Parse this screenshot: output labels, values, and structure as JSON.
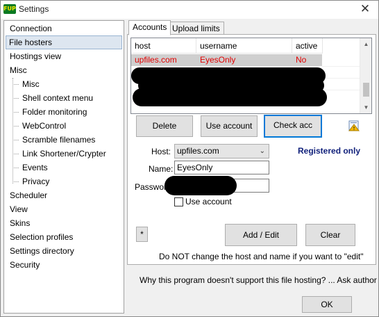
{
  "window": {
    "app_icon_text": "FUP",
    "title": "Settings",
    "close_glyph": "✕"
  },
  "sidebar": {
    "items": [
      {
        "label": "Connection"
      },
      {
        "label": "File hosters"
      },
      {
        "label": "Hostings view"
      },
      {
        "label": "Misc"
      },
      {
        "label": "Misc"
      },
      {
        "label": "Shell context menu"
      },
      {
        "label": "Folder monitoring"
      },
      {
        "label": "WebControl"
      },
      {
        "label": "Scramble filenames"
      },
      {
        "label": "Link Shortener/Crypter"
      },
      {
        "label": "Events"
      },
      {
        "label": "Privacy"
      },
      {
        "label": "Scheduler"
      },
      {
        "label": "View"
      },
      {
        "label": "Skins"
      },
      {
        "label": "Selection profiles"
      },
      {
        "label": "Settings directory"
      },
      {
        "label": "Security"
      }
    ],
    "selected_index": 1
  },
  "tabs": [
    {
      "label": "Accounts"
    },
    {
      "label": "Upload limits"
    }
  ],
  "accounts_list": {
    "columns": [
      "host",
      "username",
      "active"
    ],
    "rows": [
      {
        "host": "upfiles.com",
        "username": "EyesOnly",
        "active": "No"
      }
    ]
  },
  "buttons": {
    "delete": "Delete",
    "use_account": "Use account",
    "check_acc": "Check acc",
    "add_edit": "Add / Edit",
    "clear": "Clear",
    "star": "*",
    "ok": "OK"
  },
  "form": {
    "host_label": "Host:",
    "host_value": "upfiles.com",
    "name_label": "Name:",
    "name_value": "EyesOnly",
    "password_label": "Password",
    "use_account_checkbox": "Use account",
    "registered_only": "Registered only"
  },
  "notes": {
    "dont_change": "Do NOT change the host and name if you want to \"edit\"",
    "why_not_supported": "Why this program doesn't support this file hosting? ... Ask author :)"
  },
  "icons": {
    "tool_icon": "warning-clipboard-icon"
  },
  "colors": {
    "selected_row_text": "#e20000",
    "registered_only": "#0f1f7a",
    "focus_border": "#0078d7"
  }
}
